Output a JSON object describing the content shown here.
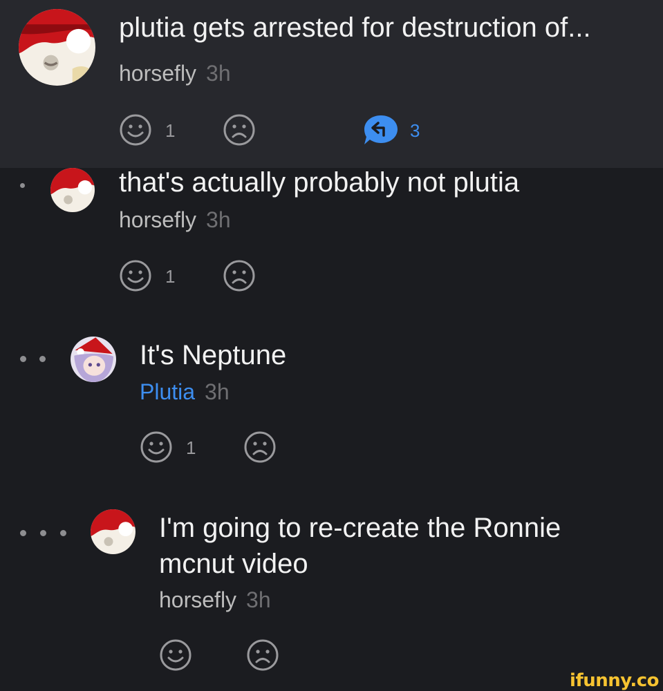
{
  "post": {
    "title": "plutia gets arrested for destruction of...",
    "author": "horsefly",
    "time": "3h",
    "smile_count": "1",
    "reply_count": "3"
  },
  "comments": [
    {
      "text": "that's actually probably not plutia",
      "author": "horsefly",
      "time": "3h",
      "smile_count": "1"
    },
    {
      "text": "It's Neptune",
      "author": "Plutia",
      "time": "3h",
      "smile_count": "1"
    },
    {
      "text_line1": "I'm going to re-create the Ronnie",
      "text_line2": "mcnut video",
      "author": "horsefly",
      "time": "3h",
      "smile_count": ""
    }
  ],
  "watermark": "ifunny.co",
  "icons": [
    "smile-icon",
    "sad-icon",
    "reply-icon",
    "avatar"
  ],
  "colors": {
    "background": "#1b1c20",
    "post_background": "#27282d",
    "accent_blue": "#3d8ef0",
    "muted_text": "#6f6f72",
    "icon_gray": "#9a9a9d",
    "watermark_yellow": "#f7c331"
  }
}
